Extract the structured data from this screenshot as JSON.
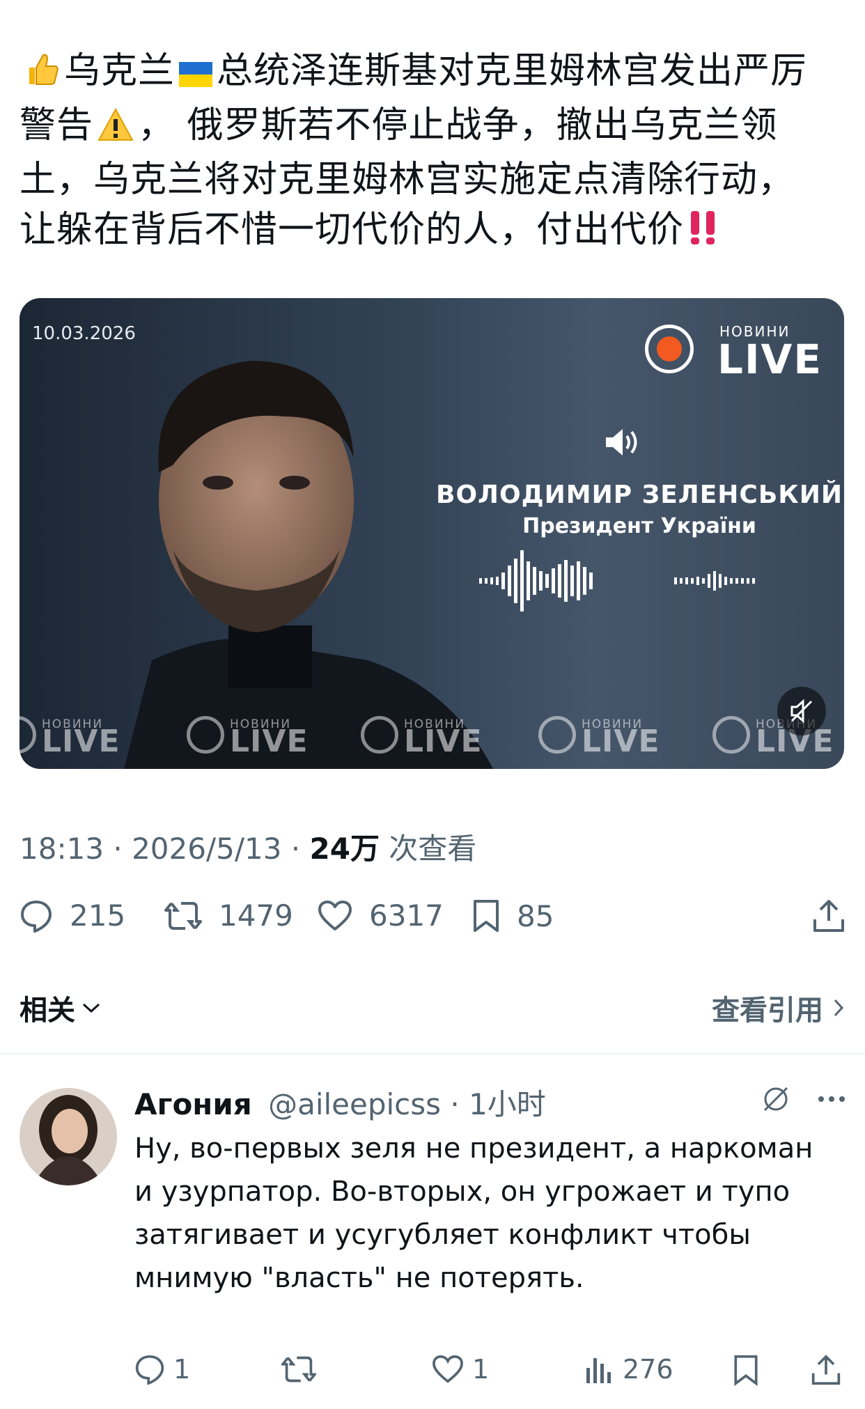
{
  "post": {
    "lines": [
      "乌克兰",
      "总统泽连斯基对克里姆林宫发出严厉",
      "警告",
      "， 俄罗斯若不停止战争，撤出乌克兰领",
      "土，乌克兰将对克里姆林宫实施定点清除行动，",
      "让躲在背后不惜一切代价的人，付出代价"
    ]
  },
  "media": {
    "date": "10.03.2026",
    "logo_small": "НОВИНИ",
    "logo_big": "LIVE",
    "speaker_name": "ВОЛОДИМИР ЗЕЛЕНСЬКИЙ",
    "speaker_role": "Президент України",
    "watermark_small": "НОВИНИ",
    "watermark_big": "LIVE"
  },
  "meta": {
    "time": "18:13 · 2026/5/13 · ",
    "views_count": "24万",
    "views_label": " 次查看"
  },
  "actions": {
    "replies": "215",
    "reposts": "1479",
    "likes": "6317",
    "bookmarks": "85"
  },
  "nav": {
    "related": "相关",
    "view_quotes": "查看引用"
  },
  "reply": {
    "name": "Агония",
    "handle": "@aileepicss",
    "time": " · 1小时",
    "body": "Ну, во-первых зеля не президент, а наркоман и узурпатор. Во-вторых, он угрожает и тупо затягивает и усугубляет конфликт чтобы мнимую \"власть\" не потерять.",
    "replies": "1",
    "likes": "1",
    "views": "276"
  },
  "colors": {
    "text": "#0f1419",
    "secondary": "#536471",
    "live_dot": "#f25a1f",
    "alert_red": "#e0245e"
  }
}
